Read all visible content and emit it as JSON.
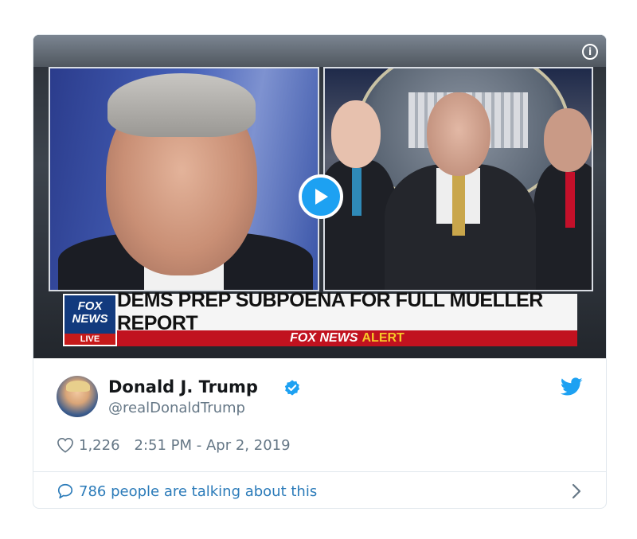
{
  "media": {
    "headline": "DEMS PREP SUBPOENA FOR FULL MUELLER REPORT",
    "alert_prefix": "FOX NEWS",
    "alert_word": "ALERT",
    "logo_line1": "FOX",
    "logo_line2": "NEWS",
    "logo_live": "LIVE",
    "info_glyph": "i"
  },
  "tweet": {
    "display_name": "Donald J. Trump",
    "handle": "@realDonaldTrump",
    "like_count": "1,226",
    "timestamp": "2:51 PM - Apr 2, 2019",
    "talking_text": "786 people are talking about this"
  },
  "colors": {
    "twitter_blue": "#1da1f2",
    "link_blue": "#2b7bb9",
    "muted_gray": "#657786",
    "fox_red": "#c1121f",
    "fox_blue": "#123a7e"
  },
  "icons": [
    "play-icon",
    "info-icon",
    "verified-icon",
    "twitter-bird-icon",
    "heart-icon",
    "comment-bubble-icon",
    "chevron-right-icon"
  ]
}
